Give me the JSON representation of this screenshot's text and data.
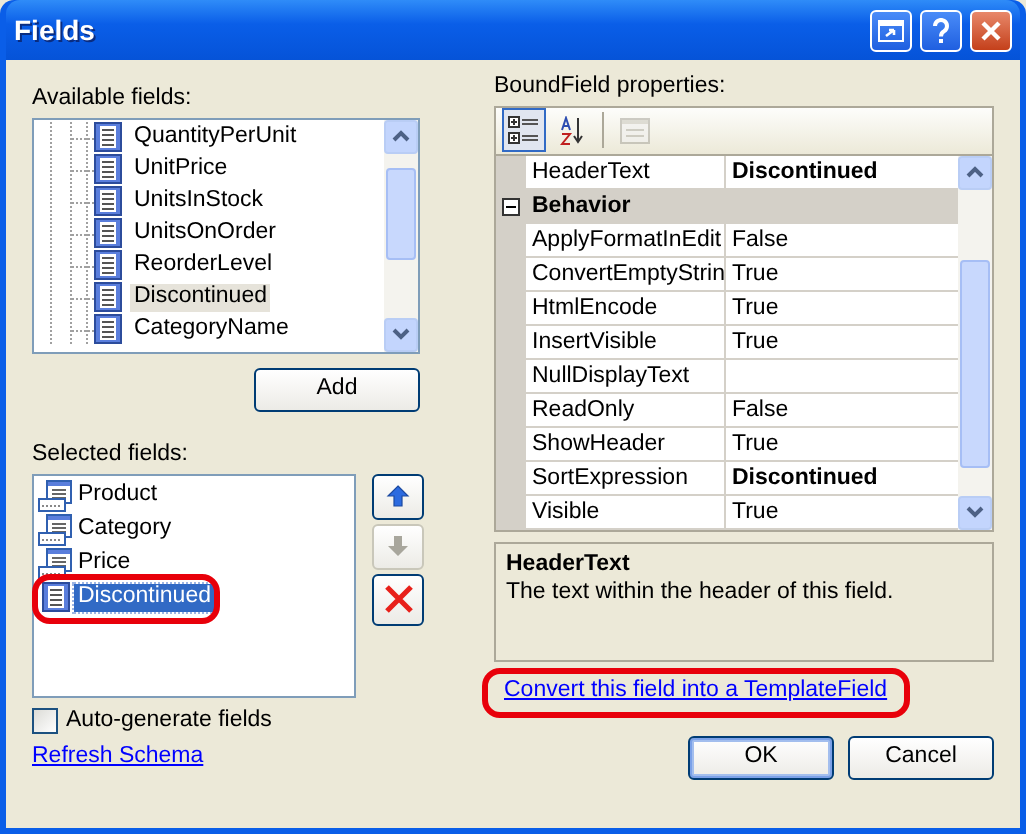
{
  "window": {
    "title": "Fields"
  },
  "available_fields": {
    "label": "Available fields:",
    "items": [
      {
        "name": "QuantityPerUnit",
        "selected": false
      },
      {
        "name": "UnitPrice",
        "selected": false
      },
      {
        "name": "UnitsInStock",
        "selected": false
      },
      {
        "name": "UnitsOnOrder",
        "selected": false
      },
      {
        "name": "ReorderLevel",
        "selected": false
      },
      {
        "name": "Discontinued",
        "selected": true
      },
      {
        "name": "CategoryName",
        "selected": false
      }
    ]
  },
  "add_button": "Add",
  "selected_fields": {
    "label": "Selected fields:",
    "items": [
      {
        "name": "Product",
        "kind": "bound",
        "selected": false,
        "circled": false
      },
      {
        "name": "Category",
        "kind": "bound",
        "selected": false,
        "circled": false
      },
      {
        "name": "Price",
        "kind": "bound",
        "selected": false,
        "circled": false
      },
      {
        "name": "Discontinued",
        "kind": "check",
        "selected": true,
        "circled": true
      }
    ]
  },
  "move_buttons": [
    {
      "kind": "up",
      "disabled": false
    },
    {
      "kind": "down",
      "disabled": true
    },
    {
      "kind": "delete",
      "disabled": false
    }
  ],
  "auto_generate": {
    "label": "Auto-generate fields",
    "checked": false
  },
  "refresh_link": "Refresh Schema",
  "properties": {
    "label": "BoundField properties:",
    "toolbar": [
      {
        "kind": "categorized",
        "pressed": true,
        "disabled": false
      },
      {
        "kind": "alphabetical",
        "pressed": false,
        "disabled": false
      },
      {
        "kind": "pages",
        "pressed": false,
        "disabled": true
      }
    ],
    "rows": [
      {
        "kind": "property",
        "name": "HeaderText",
        "value": "Discontinued",
        "bold": true
      },
      {
        "kind": "category",
        "name": "Behavior",
        "expanded": true
      },
      {
        "kind": "property",
        "name": "ApplyFormatInEdit",
        "value": "False",
        "bold": false
      },
      {
        "kind": "property",
        "name": "ConvertEmptyStrin",
        "value": "True",
        "bold": false
      },
      {
        "kind": "property",
        "name": "HtmlEncode",
        "value": "True",
        "bold": false
      },
      {
        "kind": "property",
        "name": "InsertVisible",
        "value": "True",
        "bold": false
      },
      {
        "kind": "property",
        "name": "NullDisplayText"
      },
      {
        "kind": "property",
        "name": "ReadOnly",
        "value": "False",
        "bold": false
      },
      {
        "kind": "property",
        "name": "ShowHeader",
        "value": "True",
        "bold": false
      },
      {
        "kind": "property",
        "name": "SortExpression",
        "value": "Discontinued",
        "bold": true
      },
      {
        "kind": "property",
        "name": "Visible",
        "value": "True",
        "bold": false
      }
    ]
  },
  "description": {
    "title": "HeaderText",
    "text": "The text within the header of this field."
  },
  "convert_link": {
    "text": "Convert this field into a TemplateField",
    "circled": true
  },
  "buttons": [
    {
      "label": "OK",
      "default": true
    },
    {
      "label": "Cancel",
      "default": false
    }
  ]
}
